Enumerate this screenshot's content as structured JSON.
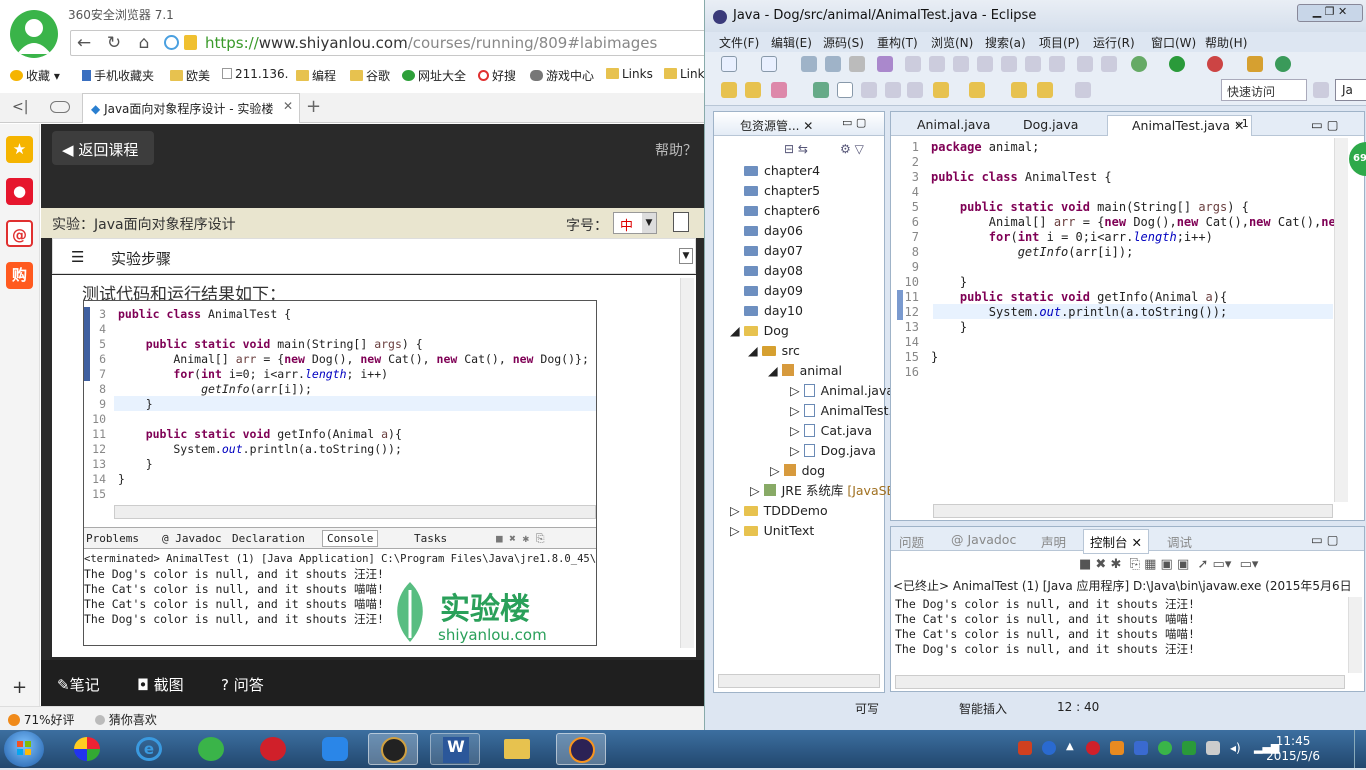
{
  "browser": {
    "title": "360安全浏览器 7.1",
    "url_scheme": "https://",
    "url_host": "www.shiyanlou.com",
    "url_path": "/courses/running/809#labimages",
    "bookmarks": [
      "收藏",
      "手机收藏夹",
      "欧美",
      "211.136.",
      "编程",
      "谷歌",
      "网址大全",
      "好搜",
      "游戏中心",
      "Links",
      "Link"
    ],
    "tab_title": "Java面向对象程序设计 - 实验楼"
  },
  "lab": {
    "back_label": "返回课程",
    "help_label": "帮助？",
    "title": "实验：Java面向对象程序设计",
    "font_label": "字号：",
    "font_value": "中",
    "steps_label": "实验步骤",
    "content_text": "测试代码和运行结果如下：",
    "code": [
      {
        "n": "3",
        "t": "public class AnimalTest {"
      },
      {
        "n": "4",
        "t": ""
      },
      {
        "n": "5",
        "t": "    public static void main(String[] args) {"
      },
      {
        "n": "6",
        "t": "        Animal[] arr = {new Dog(), new Cat(), new Cat(), new Dog()};"
      },
      {
        "n": "7",
        "t": "        for(int i=0; i<arr.length; i++)"
      },
      {
        "n": "8",
        "t": "            getInfo(arr[i]);"
      },
      {
        "n": "9",
        "t": "    }"
      },
      {
        "n": "10",
        "t": ""
      },
      {
        "n": "11",
        "t": "    public static void getInfo(Animal a){"
      },
      {
        "n": "12",
        "t": "        System.out.println(a.toString());"
      },
      {
        "n": "13",
        "t": "    }"
      },
      {
        "n": "14",
        "t": "}"
      },
      {
        "n": "15",
        "t": ""
      }
    ],
    "console_tabs": [
      "Problems",
      "@ Javadoc",
      "Declaration",
      "Console",
      "Tasks"
    ],
    "terminated": "<terminated> AnimalTest (1) [Java Application] C:\\Program Files\\Java\\jre1.8.0_45\\bin\\ja",
    "output": [
      "The Dog's color is null, and it shouts 汪汪!",
      "The Cat's color is null, and it shouts 喵喵!",
      "The Cat's color is null, and it shouts 喵喵!",
      "The Dog's color is null, and it shouts 汪汪!"
    ],
    "watermark_cn": "实验楼",
    "watermark_en": "shiyanlou.com",
    "bottom": [
      "笔记",
      "截图",
      "问答"
    ]
  },
  "statusbar": {
    "rating": "71%好评",
    "guess": "猜你喜欢"
  },
  "eclipse": {
    "title": "Java - Dog/src/animal/AnimalTest.java - Eclipse",
    "menu": [
      "文件(F)",
      "编辑(E)",
      "源码(S)",
      "重构(T)",
      "浏览(N)",
      "搜索(a)",
      "项目(P)",
      "运行(R)",
      "窗口(W)",
      "帮助(H)"
    ],
    "quick_access": "快速访问",
    "perspective": "Ja",
    "package_explorer": "包资源管...",
    "tree": [
      "chapter4",
      "chapter5",
      "chapter6",
      "day06",
      "day07",
      "day08",
      "day09",
      "day10",
      "Dog",
      "src",
      "animal",
      "Animal.java",
      "AnimalTest.",
      "Cat.java",
      "Dog.java",
      "dog",
      "JRE 系统库",
      "[JavaSE",
      "TDDDemo",
      "UnitText"
    ],
    "editor_tabs": [
      "Animal.java",
      "Dog.java",
      "AnimalTest.java",
      "»1"
    ],
    "code": [
      {
        "n": "1",
        "t": "package animal;"
      },
      {
        "n": "2",
        "t": ""
      },
      {
        "n": "3",
        "t": "public class AnimalTest {"
      },
      {
        "n": "4",
        "t": ""
      },
      {
        "n": "5",
        "t": "    public static void main(String[] args) {"
      },
      {
        "n": "6",
        "t": "        Animal[] arr = {new Dog(),new Cat(),new Cat(),new"
      },
      {
        "n": "7",
        "t": "        for(int i = 0;i<arr.length;i++)"
      },
      {
        "n": "8",
        "t": "            getInfo(arr[i]);"
      },
      {
        "n": "9",
        "t": ""
      },
      {
        "n": "10",
        "t": "    }"
      },
      {
        "n": "11",
        "t": "    public static void getInfo(Animal a){"
      },
      {
        "n": "12",
        "t": "        System.out.println(a.toString());"
      },
      {
        "n": "13",
        "t": "    }"
      },
      {
        "n": "14",
        "t": ""
      },
      {
        "n": "15",
        "t": "}"
      },
      {
        "n": "16",
        "t": ""
      }
    ],
    "badge": "69",
    "console_tabs": [
      "问题",
      "@ Javadoc",
      "声明",
      "控制台",
      "调试"
    ],
    "terminated": "<已终止> AnimalTest (1) [Java 应用程序] D:\\Java\\bin\\javaw.exe (2015年5月6日 ",
    "output": [
      "The Dog's color is null, and it shouts 汪汪!",
      "The Cat's color is null, and it shouts 喵喵!",
      "The Cat's color is null, and it shouts 喵喵!",
      "The Dog's color is null, and it shouts 汪汪!"
    ],
    "status": [
      "可写",
      "智能插入",
      "12 : 40"
    ]
  },
  "taskbar": {
    "time": "11:45",
    "date": "2015/5/6"
  }
}
